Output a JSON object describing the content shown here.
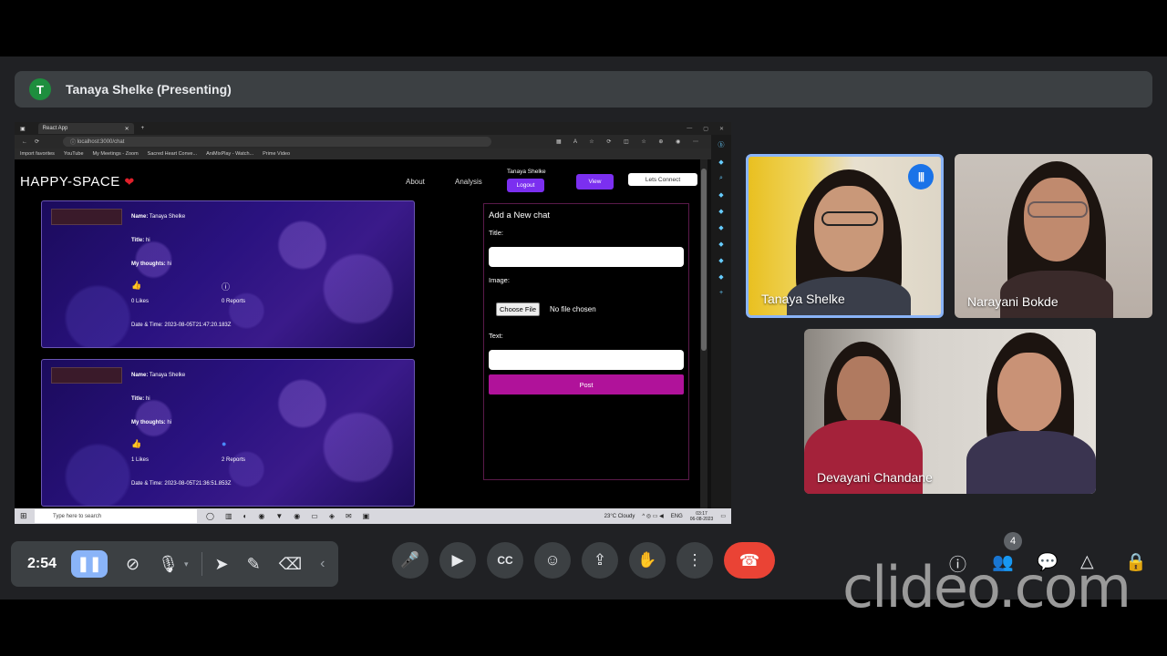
{
  "meeting": {
    "presenter_initial": "T",
    "presenting_label": "Tanaya Shelke (Presenting)",
    "timer": "2:54"
  },
  "browser": {
    "tab_title": "React App",
    "url": "localhost:3000/chat",
    "bookmarks": [
      "Import favorites",
      "YouTube",
      "My Meetings - Zoom",
      "Sacred Heart Conve...",
      "AniMixPlay - Watch...",
      "Prime Video"
    ]
  },
  "app": {
    "brand": "HAPPY-SPACE",
    "nav": {
      "about": "About",
      "analysis": "Analysis",
      "user_name": "Tanaya Shelke",
      "logout": "Logout",
      "view": "View",
      "lets_connect": "Lets Connect"
    },
    "posts": [
      {
        "name_label": "Name:",
        "name": "Tanaya Shelke",
        "title_label": "Title:",
        "title": "hi",
        "thoughts_label": "My thoughts:",
        "thoughts": "hi",
        "likes": "0 Likes",
        "reports": "0 Reports",
        "date_label": "Date & Time:",
        "date": "2023-08-05T21:47:20.183Z"
      },
      {
        "name_label": "Name:",
        "name": "Tanaya Shelke",
        "title_label": "Title:",
        "title": "hi",
        "thoughts_label": "My thoughts:",
        "thoughts": "hi",
        "likes": "1 Likes",
        "reports": "2 Reports",
        "date_label": "Date & Time:",
        "date": "2023-08-05T21:36:51.853Z"
      }
    ],
    "form": {
      "heading": "Add a New chat",
      "title_label": "Title:",
      "image_label": "Image:",
      "choose_file": "Choose File",
      "no_file": "No file chosen",
      "text_label": "Text:",
      "post_button": "Post"
    }
  },
  "taskbar": {
    "search_placeholder": "Type here to search",
    "weather": "23°C Cloudy",
    "lang": "ENG",
    "time": "03:17",
    "date": "06-08-2023"
  },
  "participants": [
    {
      "name": "Tanaya Shelke",
      "speaking": true
    },
    {
      "name": "Narayani Bokde",
      "speaking": false
    },
    {
      "name": "Devayani Chandane",
      "speaking": false
    }
  ],
  "controls": {
    "participant_count": "4"
  },
  "watermark": "clideo.com",
  "colors": {
    "accent": "#8ab4f8",
    "end_call": "#ea4335",
    "post_button": "#b0129a",
    "nav_button": "#7b2ff0"
  }
}
